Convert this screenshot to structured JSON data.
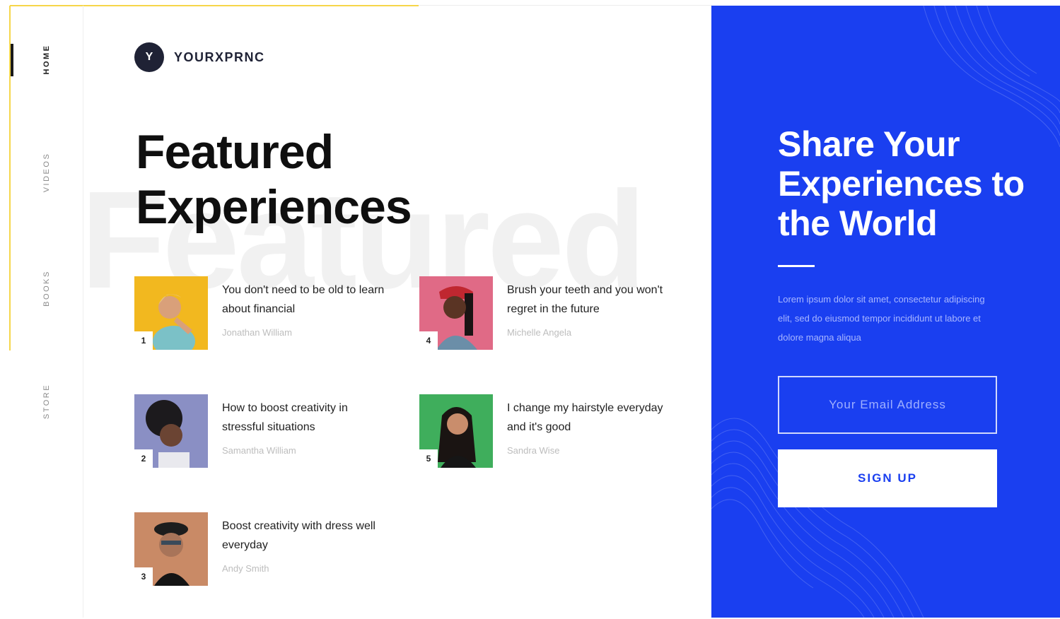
{
  "brand": {
    "initial": "Y",
    "name": "YOURXPRNC"
  },
  "nav": {
    "items": [
      {
        "label": "HOME",
        "active": true
      },
      {
        "label": "VIDEOS",
        "active": false
      },
      {
        "label": "BOOKS",
        "active": false
      },
      {
        "label": "STORE",
        "active": false
      }
    ]
  },
  "hero": {
    "line1": "Featured",
    "line2": "Experiences",
    "watermark": "Featured"
  },
  "articles": [
    {
      "number": "1",
      "title": "You don't need to be old to learn about financial",
      "author": "Jonathan William",
      "photo_bg": "#f2b81f"
    },
    {
      "number": "2",
      "title": "How to boost creativity in stressful situations",
      "author": "Samantha William",
      "photo_bg": "#8a8fc4"
    },
    {
      "number": "3",
      "title": "Boost creativity with dress well everyday",
      "author": "Andy Smith",
      "photo_bg": "#c98a66"
    },
    {
      "number": "4",
      "title": "Brush your teeth and you won't regret in the future",
      "author": "Michelle Angela",
      "photo_bg": "#e06a86"
    },
    {
      "number": "5",
      "title": "I change my hairstyle everyday and it's good",
      "author": "Sandra Wise",
      "photo_bg": "#3fae5c"
    }
  ],
  "signup": {
    "title": "Share Your Experiences to the World",
    "body": "Lorem ipsum dolor sit amet, consectetur adipiscing elit, sed do eiusmod tempor incididunt ut labore et dolore magna aliqua",
    "email_placeholder": "Your Email Address",
    "button_label": "SIGN UP"
  },
  "colors": {
    "accent": "#1a3ff0",
    "highlight": "#f6d64a",
    "dark": "#1f2235"
  }
}
